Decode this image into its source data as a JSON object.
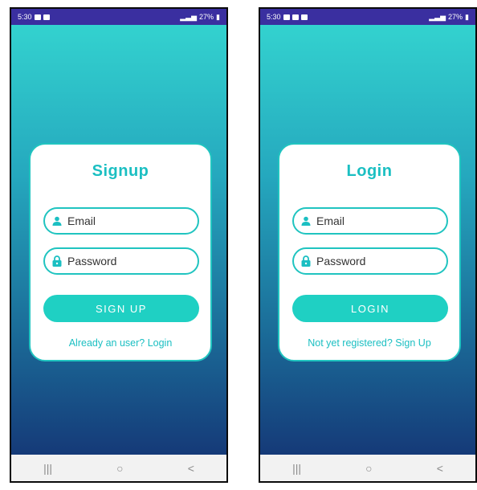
{
  "colors": {
    "accent": "#1fd0c3",
    "status_bar": "#3a2fa0",
    "gradient_top": "#33d2cf",
    "gradient_bottom": "#153a78"
  },
  "screens": [
    {
      "status": {
        "time": "5:30",
        "right": "27%"
      },
      "title": "Signup",
      "email_placeholder": "Email",
      "password_placeholder": "Password",
      "button_label": "SIGN UP",
      "switch_link": "Already an user? Login",
      "nav": [
        "|||",
        "○",
        "<"
      ]
    },
    {
      "status": {
        "time": "5:30",
        "right": "27%"
      },
      "title": "Login",
      "email_placeholder": "Email",
      "password_placeholder": "Password",
      "button_label": "LOGIN",
      "switch_link": "Not yet registered? Sign Up",
      "nav": [
        "|||",
        "○",
        "<"
      ]
    }
  ],
  "icons": {
    "email": "person-icon",
    "password": "lock-icon"
  }
}
